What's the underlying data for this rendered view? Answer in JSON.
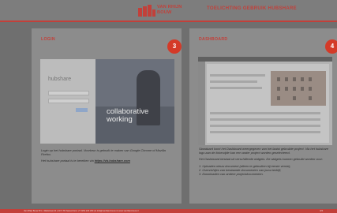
{
  "header": {
    "brand_line1": "VAN RHIJN",
    "brand_line2": "BOUW",
    "doc_title": "TOELICHTING GEBRUIK HUBSHARE"
  },
  "left_panel": {
    "title": "LOGIN",
    "step": "3",
    "screenshot": {
      "app_logo": "hubshare",
      "overlay_line1": "collaborative",
      "overlay_line2": "working"
    },
    "para1": "Login op het hubshare portaal. Voorkeur is gebruik te maken van Google Chrome of Mozilla Firefox.",
    "para2_prefix": "Het hubshare portaal is te bereiken via ",
    "para2_link": "https://vb.hubshare.com"
  },
  "right_panel": {
    "title": "DASHBOARD",
    "step": "4",
    "para1": "Standaard komt het Dashboard weergegeven van het laatst gebruikte project. Via het hubshare logo aan de linkerzijde kan een ander project worden geselecteerd.",
    "para2": "Het Dashboard bestaat uit verschillende widgets. De widgets kunnen gebruikt worden voor:",
    "list": [
      "1. Uploaden nieuw document (alleen te gebruiken bij eerste versie);",
      "2. Overzichtjes van bestaande documenten van jouw bedrijf;",
      "3. Downloaden van andere projectdocumenten."
    ]
  },
  "footer": {
    "text": "Van Rhijn Bouw B.V. | Wattstraat 24 | 2171 TR Sassenheim | T 0252 220 290 | E info@vanrhijn-bouw.nl | www.vanrhijn-bouw.nl",
    "page": "4/4"
  },
  "colors": {
    "accent": "#c2403a",
    "badge": "#d43a28",
    "background": "#6f6f6f",
    "panel": "#8c8c8c"
  }
}
